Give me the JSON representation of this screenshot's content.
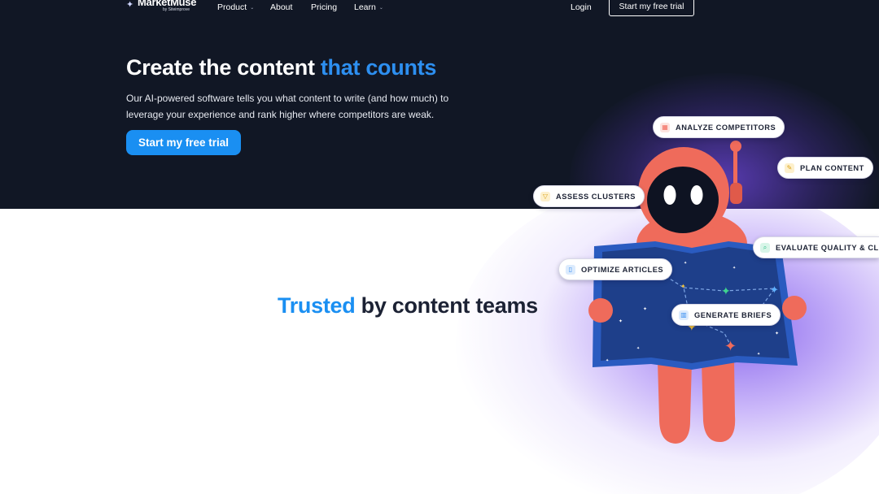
{
  "nav": {
    "logo_text": "MarketMuse",
    "logo_sub": "by Siteimprove",
    "items": [
      {
        "label": "Product",
        "has_dropdown": true
      },
      {
        "label": "About",
        "has_dropdown": false
      },
      {
        "label": "Pricing",
        "has_dropdown": false
      },
      {
        "label": "Learn",
        "has_dropdown": true
      }
    ],
    "login_label": "Login",
    "cta_label": "Start my free trial"
  },
  "hero": {
    "title_main": "Create the content ",
    "title_accent": "that counts",
    "description": "Our AI-powered software tells you what content to write (and how much) to leverage your experience and rank higher where competitors are weak.",
    "cta_label": "Start my free trial"
  },
  "trusted": {
    "accent": "Trusted",
    "rest": " by content teams"
  },
  "features": [
    {
      "label": "ANALYZE COMPETITORS",
      "icon": "grid-icon",
      "color": "#f26a5c"
    },
    {
      "label": "PLAN CONTENT",
      "icon": "lightbulb-icon",
      "color": "#f2c23a"
    },
    {
      "label": "ASSESS CLUSTERS",
      "icon": "funnel-icon",
      "color": "#f2c23a"
    },
    {
      "label": "EVALUATE QUALITY & CLAIMS",
      "icon": "magnifier-icon",
      "color": "#2fc28a"
    },
    {
      "label": "OPTIMIZE ARTICLES",
      "icon": "document-icon",
      "color": "#3a8ff0"
    },
    {
      "label": "GENERATE BRIEFS",
      "icon": "brief-icon",
      "color": "#3a8ff0"
    }
  ],
  "colors": {
    "hero_bg": "#111725",
    "accent_blue": "#1a8ff2",
    "robot_coral": "#ef6b5b",
    "map_blue": "#1e3f8a"
  }
}
